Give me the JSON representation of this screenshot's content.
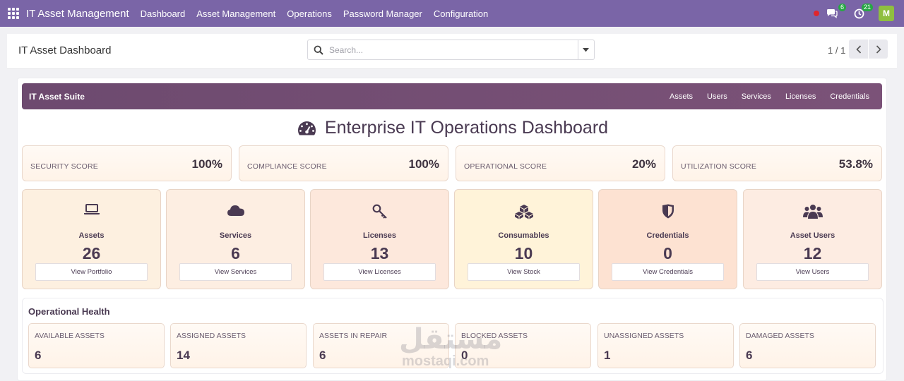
{
  "topbar": {
    "app_title": "IT Asset Management",
    "menu": [
      "Dashboard",
      "Asset Management",
      "Operations",
      "Password Manager",
      "Configuration"
    ],
    "chat_count": "6",
    "activity_count": "21",
    "avatar_letter": "M",
    "colors": {
      "bar": "#7a65a7",
      "badge": "#28a745",
      "avatar": "#8fbf3f"
    }
  },
  "control": {
    "title": "IT Asset Dashboard",
    "search_placeholder": "Search...",
    "pager": "1 / 1"
  },
  "suite": {
    "title": "IT Asset Suite",
    "links": [
      "Assets",
      "Users",
      "Services",
      "Licenses",
      "Credentials"
    ]
  },
  "dashboard_title": "Enterprise IT Operations Dashboard",
  "scores": [
    {
      "label": "SECURITY SCORE",
      "value": "100%"
    },
    {
      "label": "COMPLIANCE SCORE",
      "value": "100%"
    },
    {
      "label": "OPERATIONAL SCORE",
      "value": "20%"
    },
    {
      "label": "UTILIZATION SCORE",
      "value": "53.8%"
    }
  ],
  "categories": [
    {
      "name": "Assets",
      "count": "26",
      "button": "View Portfolio",
      "icon": "laptop-icon",
      "bg": "#fdf0e0"
    },
    {
      "name": "Services",
      "count": "6",
      "button": "View Services",
      "icon": "cloud-icon",
      "bg": "#fdeee2"
    },
    {
      "name": "Licenses",
      "count": "13",
      "button": "View Licenses",
      "icon": "key-icon",
      "bg": "#fde8dc"
    },
    {
      "name": "Consumables",
      "count": "10",
      "button": "View Stock",
      "icon": "cubes-icon",
      "bg": "#fff3d9"
    },
    {
      "name": "Credentials",
      "count": "0",
      "button": "View Credentials",
      "icon": "shield-icon",
      "bg": "#fde2d2"
    },
    {
      "name": "Asset Users",
      "count": "12",
      "button": "View Users",
      "icon": "users-icon",
      "bg": "#fdece2"
    }
  ],
  "health": {
    "title": "Operational Health",
    "items": [
      {
        "label": "AVAILABLE ASSETS",
        "value": "6"
      },
      {
        "label": "ASSIGNED ASSETS",
        "value": "14"
      },
      {
        "label": "ASSETS IN REPAIR",
        "value": "6"
      },
      {
        "label": "BLOCKED ASSETS",
        "value": "0"
      },
      {
        "label": "UNASSIGNED ASSETS",
        "value": "1"
      },
      {
        "label": "DAMAGED ASSETS",
        "value": "6"
      }
    ]
  },
  "watermark": {
    "arabic": "مستقل",
    "latin": "mostaqi.com"
  }
}
